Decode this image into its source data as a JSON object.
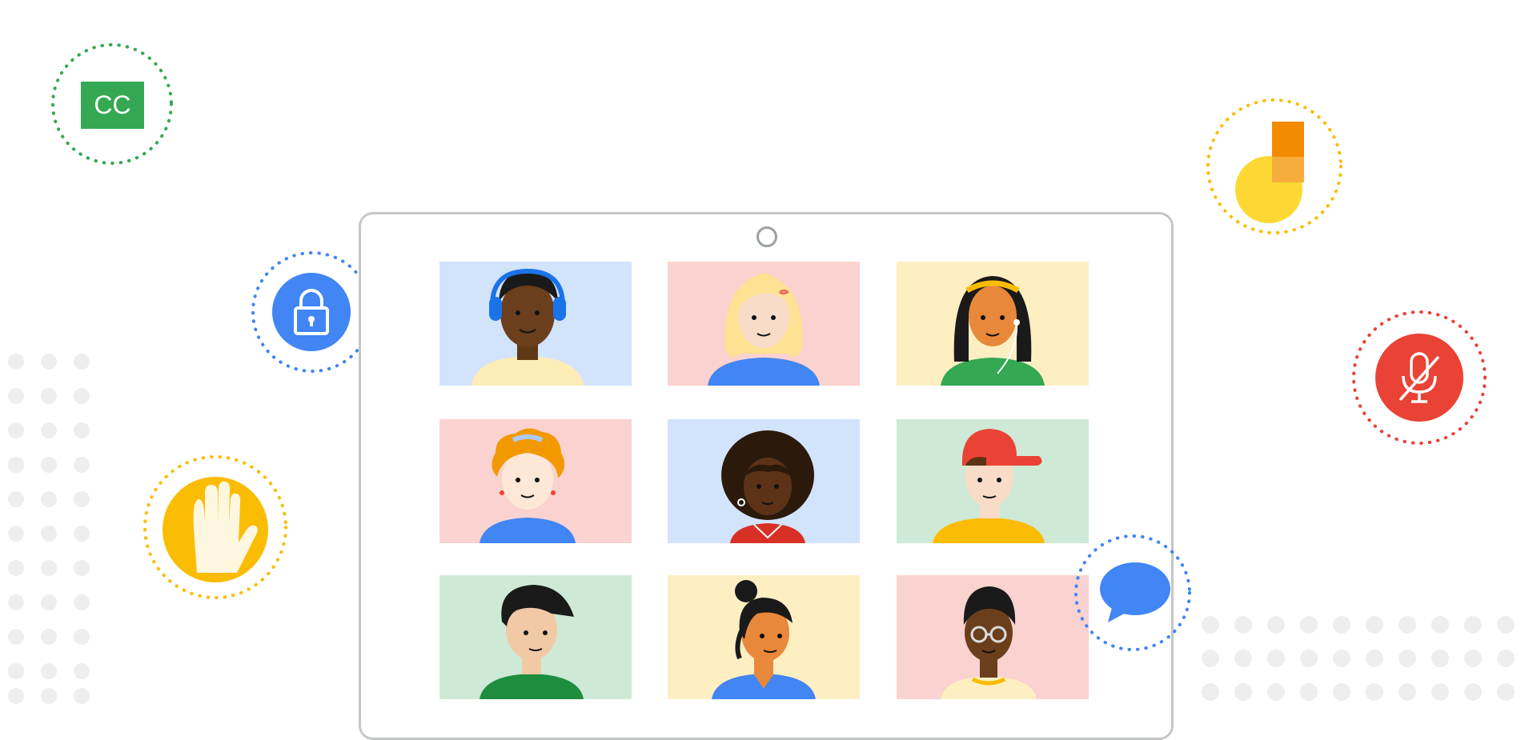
{
  "illustration": {
    "features": [
      {
        "name": "captions",
        "label": "CC",
        "icon": "closed-captions-icon",
        "color": "#34a853"
      },
      {
        "name": "security",
        "icon": "lock-icon",
        "color": "#4285f4"
      },
      {
        "name": "raise-hand",
        "icon": "raised-hand-icon",
        "color": "#fbbc04"
      },
      {
        "name": "jamboard",
        "icon": "jamboard-icon",
        "color": "#fbbc04"
      },
      {
        "name": "mute",
        "icon": "muted-microphone-icon",
        "color": "#ea4335"
      },
      {
        "name": "chat",
        "icon": "chat-bubble-icon",
        "color": "#4285f4"
      }
    ],
    "participants": [
      {
        "bg": "#d2e3fc"
      },
      {
        "bg": "#fad2cf"
      },
      {
        "bg": "#feefc3"
      },
      {
        "bg": "#fad2cf"
      },
      {
        "bg": "#d2e3fc"
      },
      {
        "bg": "#ceead6"
      },
      {
        "bg": "#ceead6"
      },
      {
        "bg": "#feefc3"
      },
      {
        "bg": "#fad2cf"
      }
    ]
  }
}
